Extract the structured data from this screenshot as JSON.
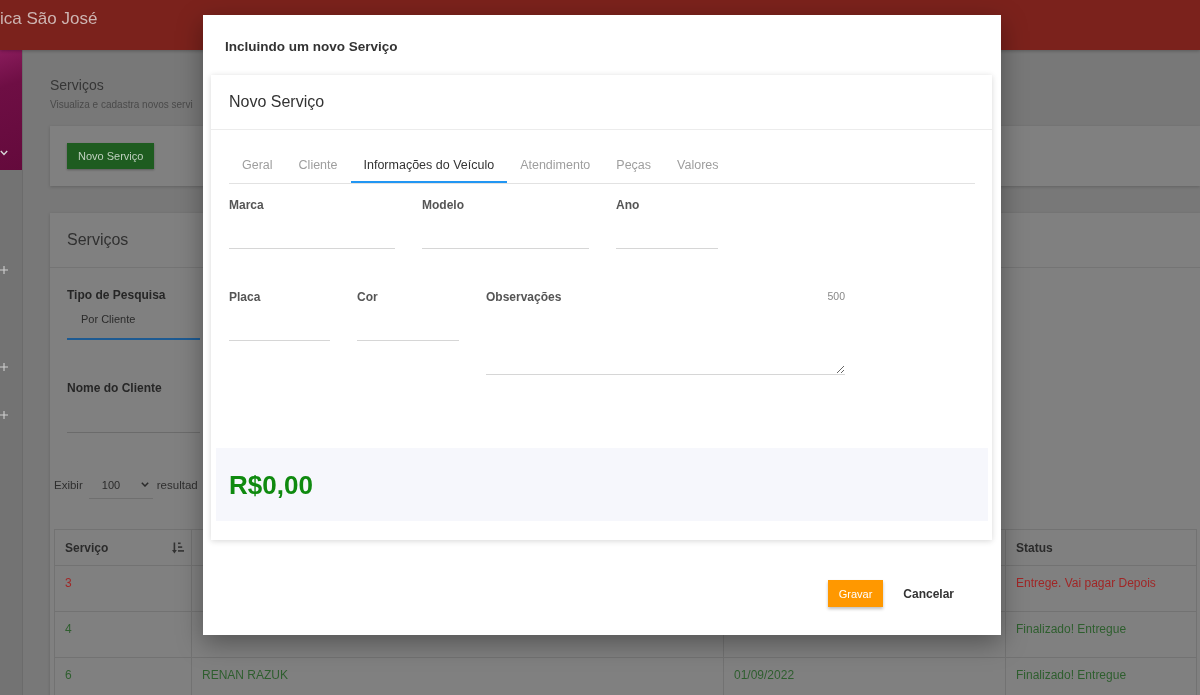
{
  "app_bar": {
    "title": "ica São José"
  },
  "sidebar": {
    "items": [
      {
        "selected": true,
        "expanded": true
      },
      {
        "selected": false,
        "expanded": false
      },
      {
        "selected": false,
        "expanded": false
      },
      {
        "selected": false,
        "expanded": false
      }
    ]
  },
  "page": {
    "title": "Serviços",
    "subtitle": "Visualiza e cadastra novos servi",
    "new_button": "Novo Serviço"
  },
  "services_card": {
    "title": "Serviços",
    "search_type": {
      "label": "Tipo de Pesquisa",
      "value": "Por Cliente"
    },
    "client_name": {
      "label": "Nome do Cliente"
    },
    "page_size": {
      "prefix": "Exibir",
      "value": "100",
      "suffix": "resultad"
    },
    "table": {
      "columns": {
        "service": "Serviço",
        "status": "Status"
      },
      "rows": [
        {
          "service": "3",
          "status": "Entrege. Vai pagar Depois",
          "color": "#a02626"
        },
        {
          "service": "4",
          "status": "Finalizado! Entregue",
          "color": "#2e5e2e"
        },
        {
          "service": "6",
          "column_2": "RENAN RAZUK",
          "column_3": "01/09/2022",
          "status": "Finalizado! Entregue",
          "color": "#2e5e2e"
        }
      ]
    }
  },
  "dialog": {
    "title": "Incluindo um novo Serviço",
    "card_title": "Novo Serviço",
    "tabs": [
      {
        "label": "Geral",
        "selected": false
      },
      {
        "label": "Cliente",
        "selected": false
      },
      {
        "label": "Informações do Veículo",
        "selected": true
      },
      {
        "label": "Atendimento",
        "selected": false
      },
      {
        "label": "Peças",
        "selected": false
      },
      {
        "label": "Valores",
        "selected": false
      }
    ],
    "fields": [
      [
        {
          "label": "Marca",
          "kind": "text"
        },
        {
          "label": "Modelo",
          "kind": "text"
        },
        {
          "label": "Ano",
          "kind": "text"
        }
      ],
      [
        {
          "label": "Placa",
          "kind": "text"
        },
        {
          "label": "Cor",
          "kind": "text"
        },
        {
          "label": "Observações",
          "kind": "textarea",
          "counter": "500"
        }
      ]
    ],
    "total": "R$0,00",
    "buttons": [
      {
        "label": "Gravar",
        "kind": "primary"
      },
      {
        "label": "Cancelar",
        "kind": "flat"
      }
    ]
  }
}
